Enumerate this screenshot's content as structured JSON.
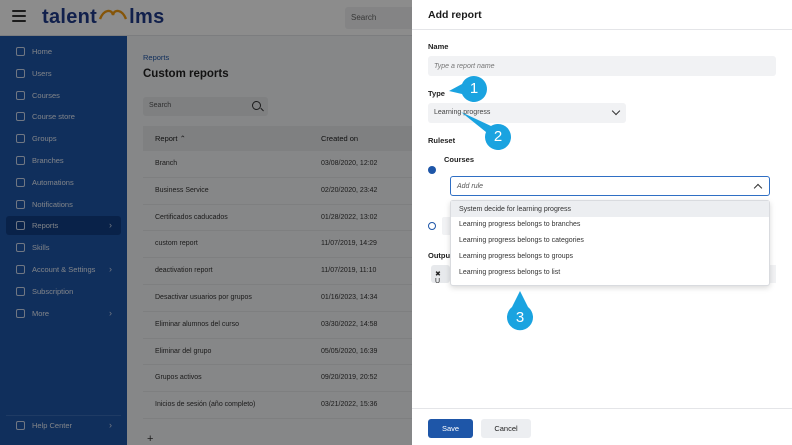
{
  "topbar": {
    "logo_left": "talent",
    "logo_right": "lms",
    "search_placeholder": "Search"
  },
  "sidebar": {
    "items": [
      {
        "label": "Home",
        "icon": "home-icon"
      },
      {
        "label": "Users",
        "icon": "user-icon"
      },
      {
        "label": "Courses",
        "icon": "book-icon"
      },
      {
        "label": "Course store",
        "icon": "store-icon"
      },
      {
        "label": "Groups",
        "icon": "group-icon"
      },
      {
        "label": "Branches",
        "icon": "branches-icon"
      },
      {
        "label": "Automations",
        "icon": "automation-icon"
      },
      {
        "label": "Notifications",
        "icon": "bell-icon"
      },
      {
        "label": "Reports",
        "icon": "reports-icon",
        "active": true,
        "chevron": true
      },
      {
        "label": "Skills",
        "icon": "skills-icon"
      },
      {
        "label": "Account & Settings",
        "icon": "gear-icon",
        "chevron": true
      },
      {
        "label": "Subscription",
        "icon": "subscription-icon"
      },
      {
        "label": "More",
        "icon": "grid-icon",
        "chevron": true
      }
    ],
    "help_center": "Help Center"
  },
  "main": {
    "breadcrumb": "Reports",
    "title": "Custom reports",
    "search_placeholder": "Search",
    "table": {
      "headers": [
        "Report",
        "Created on"
      ],
      "rows": [
        [
          "Branch",
          "03/08/2020, 12:02"
        ],
        [
          "Business Service",
          "02/20/2020, 23:42"
        ],
        [
          "Certificados caducados",
          "01/28/2022, 13:02"
        ],
        [
          "custom report",
          "11/07/2019, 14:29"
        ],
        [
          "deactivation report",
          "11/07/2019, 11:10"
        ],
        [
          "Desactivar usuarios por grupos",
          "01/16/2023, 14:34"
        ],
        [
          "Eliminar alumnos del curso",
          "03/30/2022, 14:58"
        ],
        [
          "Eliminar del grupo",
          "05/05/2020, 16:39"
        ],
        [
          "Grupos activos",
          "09/20/2019, 20:52"
        ],
        [
          "Inicios de sesión (año completo)",
          "03/21/2022, 15:36"
        ]
      ]
    },
    "add_symbol": "+"
  },
  "drawer": {
    "title": "Add report",
    "name_label": "Name",
    "name_placeholder": "Type a report name",
    "type_label": "Type",
    "type_value": "Learning progress",
    "ruleset_label": "Ruleset",
    "courses_label": "Courses",
    "add_rule_placeholder": "Add rule",
    "rule_options": [
      "System decide for learning progress",
      "Learning progress belongs to branches",
      "Learning progress belongs to categories",
      "Learning progress belongs to groups",
      "Learning progress belongs to list"
    ],
    "output_label": "Outpu",
    "chip_text": "U",
    "save_label": "Save",
    "cancel_label": "Cancel"
  },
  "callouts": [
    "1",
    "2",
    "3"
  ],
  "colors": {
    "brand_blue": "#1e56a8",
    "callout_blue": "#1aa3e0"
  }
}
